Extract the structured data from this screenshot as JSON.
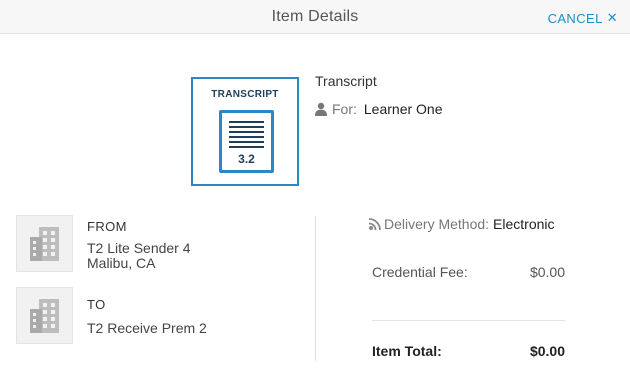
{
  "header": {
    "title": "Item Details",
    "cancel_label": "CANCEL",
    "cancel_icon": "close-icon"
  },
  "item": {
    "thumbnail_title": "TRANSCRIPT",
    "thumbnail_number": "3.2",
    "name": "Transcript",
    "for_label": "For:",
    "for_value": "Learner One"
  },
  "from": {
    "heading": "FROM",
    "name": "T2 Lite Sender 4",
    "location": "Malibu, CA",
    "icon": "building-icon"
  },
  "to": {
    "heading": "TO",
    "name": "T2 Receive Prem 2",
    "icon": "building-icon"
  },
  "delivery": {
    "label": "Delivery Method:",
    "value": "Electronic",
    "icon": "electronic-delivery-icon"
  },
  "fees": {
    "credential_fee_label": "Credential Fee:",
    "credential_fee_value": "$0.00",
    "total_label": "Item Total:",
    "total_value": "$0.00"
  },
  "colors": {
    "accent": "#1a8fc9",
    "thumbnail_border": "#2a88c4",
    "thumbnail_ink": "#1f3e5a"
  }
}
